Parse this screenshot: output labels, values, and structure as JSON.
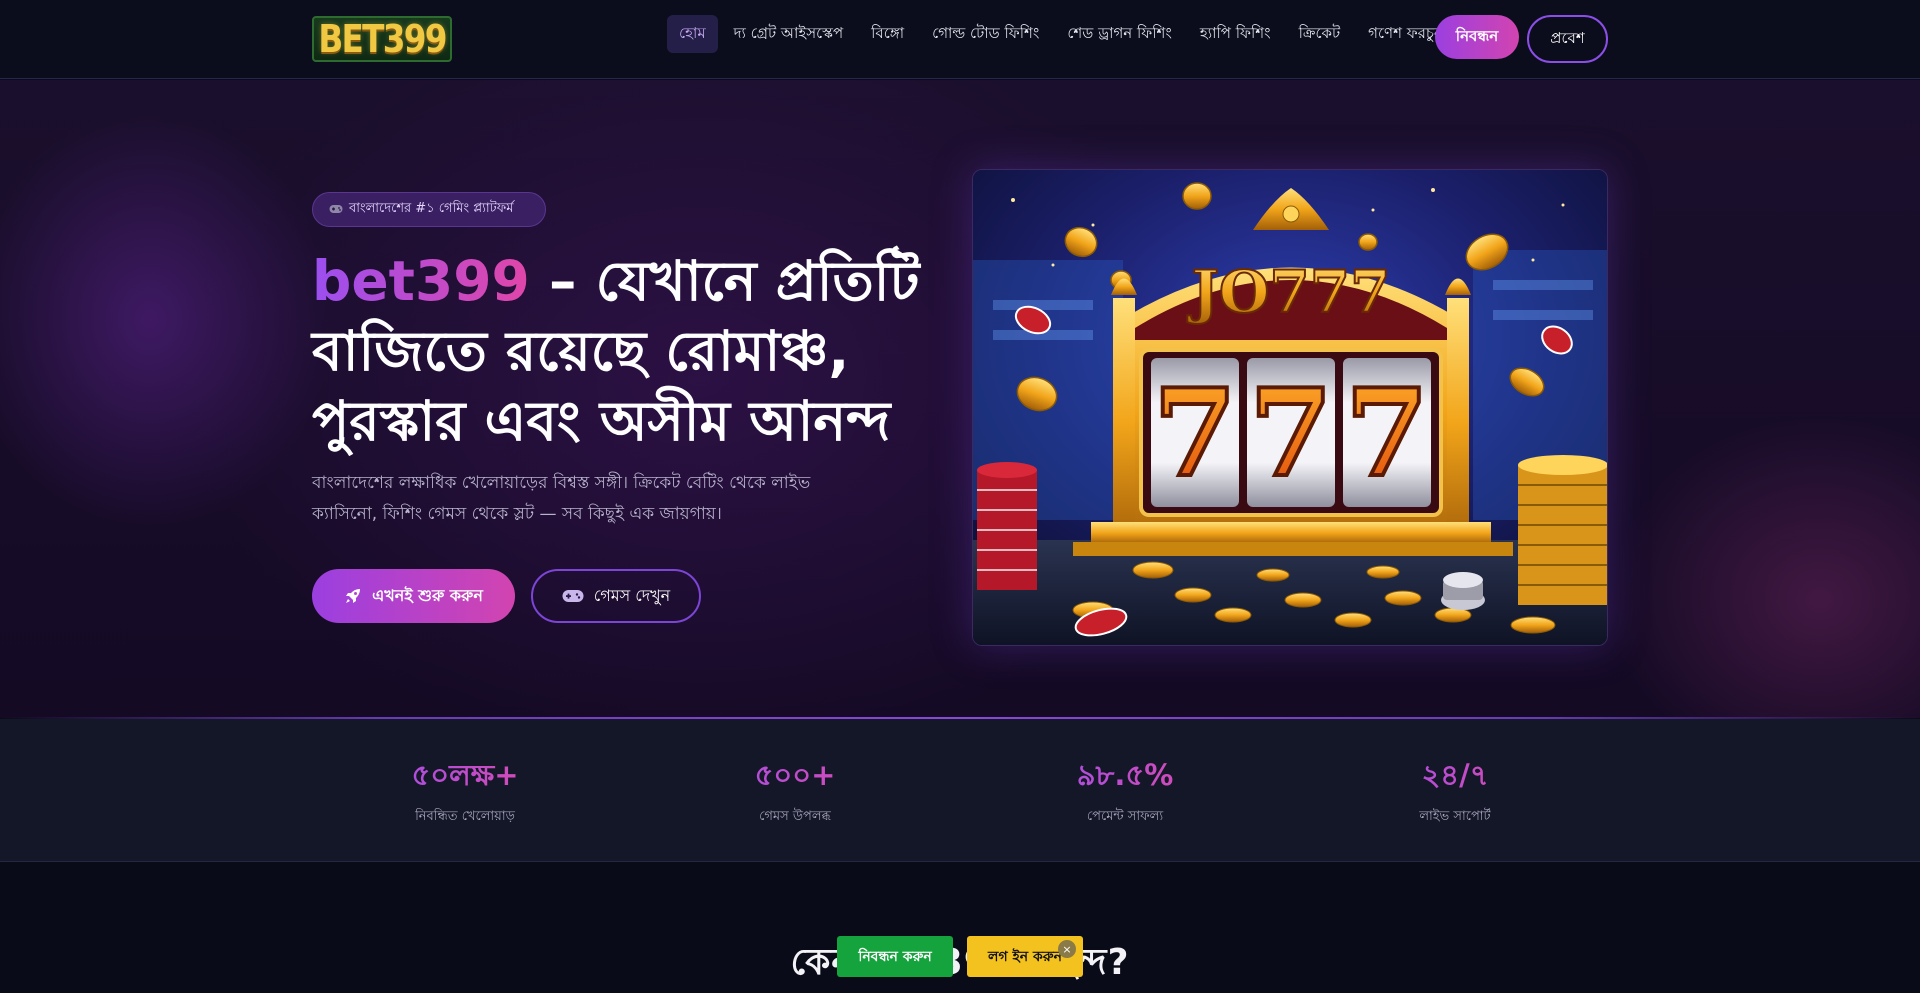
{
  "header": {
    "logo_text": "BET399",
    "nav": [
      "হোম",
      "দ্য গ্রেট আইসস্কেপ",
      "বিঙ্গো",
      "গোল্ড টোড ফিশিং",
      "শেড ড্রাগন ফিশিং",
      "হ্যাপি ফিশিং",
      "ক্রিকেট",
      "গণেশ ফরচুন"
    ],
    "register_label": "নিবন্ধন",
    "login_label": "প্রবেশ"
  },
  "hero": {
    "badge": "বাংলাদেশের #১ গেমিং প্ল্যাটফর্ম",
    "badge_icon": "gamepad-icon",
    "title_brand": "bet399",
    "title_rest": "– যেখানে প্রতিটি বাজিতে রয়েছে রোমাঞ্চ, পুরস্কার এবং অসীম আনন্দ",
    "description": "বাংলাদেশের লক্ষাধিক খেলোয়াড়ের বিশ্বস্ত সঙ্গী। ক্রিকেট বেটিং থেকে লাইভ ক্যাসিনো, ফিশিং গেমস থেকে স্লট — সব কিছুই এক জায়গায়।",
    "start_label": "এখনই শুরু করুন",
    "start_icon": "rocket-icon",
    "games_label": "গেমস দেখুন",
    "games_icon": "gamepad-icon",
    "image_sign": "JO777",
    "image_reels": [
      "7",
      "7",
      "7"
    ]
  },
  "stats": [
    {
      "value": "৫০লক্ষ+",
      "label": "নিবন্ধিত খেলোয়াড়"
    },
    {
      "value": "৫০০+",
      "label": "গেমস উপলব্ধ"
    },
    {
      "value": "৯৮.৫%",
      "label": "পেমেন্ট সাফল্য"
    },
    {
      "value": "২৪/৭",
      "label": "লাইভ সাপোর্ট"
    }
  ],
  "section": {
    "title": "কেন bet399 পছন্দ?"
  },
  "floating_bar": {
    "register_label": "নিবন্ধন করুন",
    "login_label": "লগ ইন করুন",
    "close_label": "×"
  },
  "colors": {
    "accent_purple": "#9b3fe0",
    "accent_pink": "#d244b0",
    "register_green": "#14a33c",
    "login_yellow": "#f4c21e"
  }
}
